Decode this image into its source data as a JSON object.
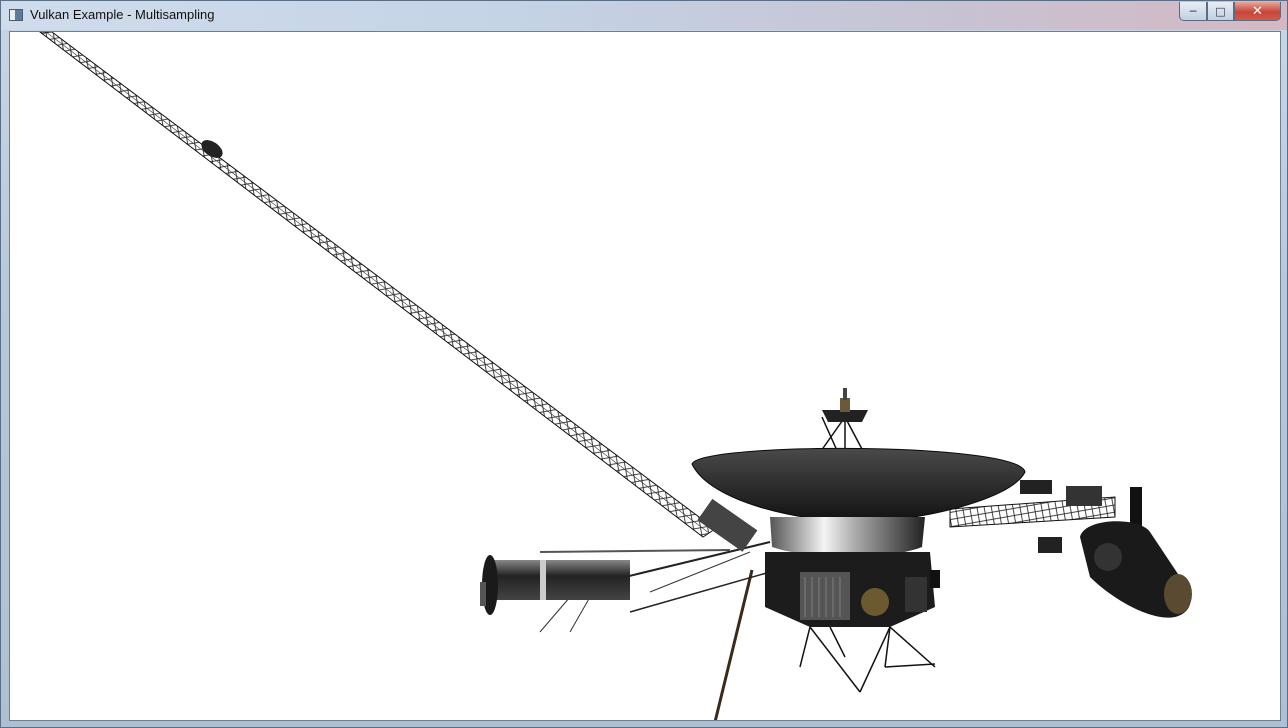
{
  "window": {
    "title": "Vulkan Example - Multisampling",
    "icon": "app-window-icon",
    "controls": {
      "minimize": "─",
      "maximize": "□",
      "close": "✕"
    }
  },
  "viewport": {
    "background": "#ffffff",
    "model": "spacecraft-3d-model"
  }
}
